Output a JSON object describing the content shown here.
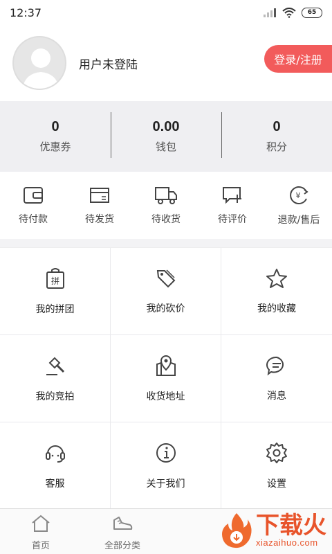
{
  "status_bar": {
    "time": "12:37",
    "battery": "65"
  },
  "profile": {
    "username": "用户未登陆",
    "login_label": "登录/注册"
  },
  "stats": [
    {
      "value": "0",
      "label": "优惠券"
    },
    {
      "value": "0.00",
      "label": "钱包"
    },
    {
      "value": "0",
      "label": "积分"
    }
  ],
  "orders": [
    {
      "icon": "wallet-icon",
      "label": "待付款"
    },
    {
      "icon": "box-icon",
      "label": "待发货"
    },
    {
      "icon": "truck-icon",
      "label": "待收货"
    },
    {
      "icon": "comment-add-icon",
      "label": "待评价"
    },
    {
      "icon": "refund-icon",
      "label": "退款/售后"
    }
  ],
  "grid": [
    {
      "icon": "group-buy-icon",
      "label": "我的拼团",
      "icon_text": "拼"
    },
    {
      "icon": "price-tag-icon",
      "label": "我的砍价"
    },
    {
      "icon": "star-icon",
      "label": "我的收藏"
    },
    {
      "icon": "auction-hammer-icon",
      "label": "我的竞拍"
    },
    {
      "icon": "map-pin-icon",
      "label": "收货地址"
    },
    {
      "icon": "message-icon",
      "label": "消息"
    },
    {
      "icon": "headset-icon",
      "label": "客服"
    },
    {
      "icon": "info-icon",
      "label": "关于我们"
    },
    {
      "icon": "settings-gear-icon",
      "label": "设置"
    }
  ],
  "tabbar": [
    {
      "icon": "home-icon",
      "label": "首页"
    },
    {
      "icon": "shoe-icon",
      "label": "全部分类"
    }
  ],
  "watermark": {
    "title": "下载火",
    "subtitle": "xiazaihuo.com"
  },
  "colors": {
    "accent": "#f25b5b",
    "stats_bg": "#efeff2",
    "watermark": "#e8542b"
  }
}
